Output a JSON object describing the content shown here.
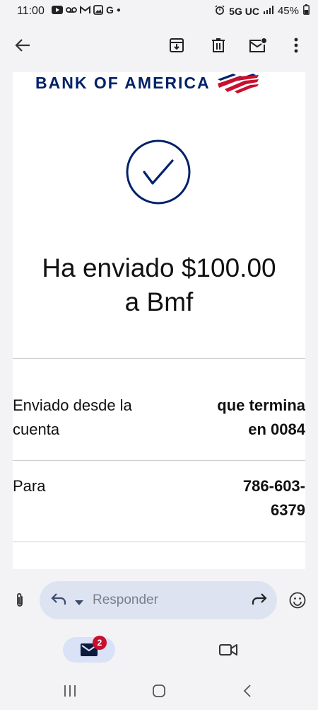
{
  "status_bar": {
    "time": "11:00",
    "network": "5G UC",
    "battery": "45%"
  },
  "app_bar": {
    "back_icon": "arrow-back-icon",
    "actions": [
      "archive-icon",
      "delete-icon",
      "mark-unread-icon",
      "more-vert-icon"
    ]
  },
  "email": {
    "brand": "BANK OF AMERICA",
    "headline_line1": "Ha enviado $100.00",
    "headline_line2": "a Bmf",
    "rows": [
      {
        "label_line1": "Enviado desde la",
        "label_line2": "cuenta",
        "value_line1": "que termina",
        "value_line2": "en 0084"
      },
      {
        "label_line1": "Para",
        "label_line2": "",
        "value_line1": "786-603-",
        "value_line2": "6379"
      }
    ]
  },
  "reply_bar": {
    "placeholder": "Responder"
  },
  "bottom_nav": {
    "mail_badge": "2"
  },
  "colors": {
    "brand_blue": "#012169",
    "brand_red": "#c8102e",
    "background": "#f3f3f6"
  }
}
